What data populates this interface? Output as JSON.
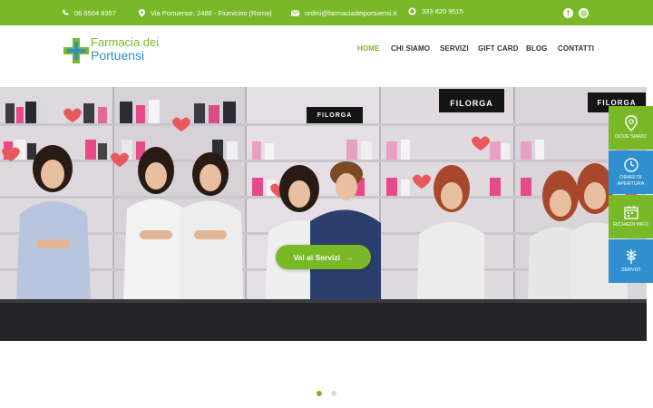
{
  "topbar": {
    "phone": "06 6504 8357",
    "address": "Via Portuense, 2488 - Fiumicino (Roma)",
    "email": "ordini@farmaciadeiportuensi.it",
    "whatsapp": "333 820 9515",
    "social": [
      {
        "icon": "facebook-icon",
        "glyph": "f"
      },
      {
        "icon": "instagram-icon",
        "glyph": "◎"
      }
    ]
  },
  "logo": {
    "line1": "Farmacia dei",
    "line2": "Portuensi"
  },
  "nav": {
    "items": [
      {
        "label": "HOME",
        "active": true
      },
      {
        "label": "CHI SIAMO",
        "active": false
      },
      {
        "label": "SERVIZI",
        "active": false
      },
      {
        "label": "GIFT CARD",
        "active": false
      },
      {
        "label": "BLOG",
        "active": false
      },
      {
        "label": "CONTATTI",
        "active": false
      }
    ]
  },
  "hero": {
    "cta_label": "Vai ai Servizi",
    "cta_arrow": "→",
    "signs": [
      "FILORGA",
      "FILORGA",
      "FILORGA"
    ]
  },
  "side_buttons": [
    {
      "label": "DOVE SIAMO",
      "icon": "map-pin-icon",
      "color": "#79b928"
    },
    {
      "label": "ORARI DI APERTURA",
      "icon": "clock-icon",
      "color": "#2f8fcf"
    },
    {
      "label": "RICHIEDI INFO",
      "icon": "calendar-icon",
      "color": "#79b928"
    },
    {
      "label": "SERVIZI",
      "icon": "caduceus-icon",
      "color": "#2f8fcf"
    }
  ],
  "carousel": {
    "slides": 2,
    "active": 0
  },
  "colors": {
    "brand_green": "#79b928",
    "brand_blue": "#2f8fcf"
  }
}
